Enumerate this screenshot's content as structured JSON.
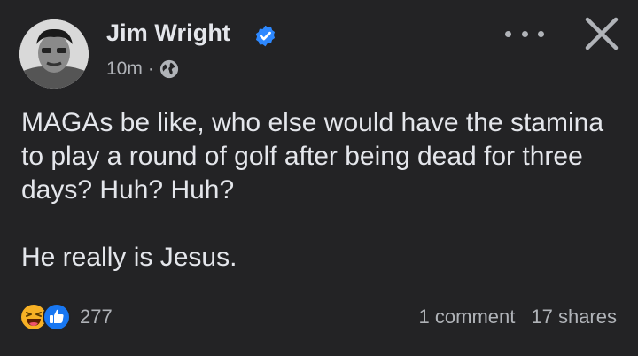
{
  "post": {
    "author": "Jim Wright",
    "time": "10m",
    "separator": "·",
    "verified": true,
    "privacy_icon": "globe-icon",
    "body_lines": [
      "MAGAs be like, who else would have the stamina to play a round of golf after being dead for three days? Huh? Huh?",
      "He really is Jesus."
    ]
  },
  "reactions": {
    "icons": [
      "haha-icon",
      "like-icon"
    ],
    "count": "277"
  },
  "stats": {
    "comments": "1 comment",
    "shares": "17 shares"
  },
  "colors": {
    "background": "#232325",
    "text_primary": "#e4e6eb",
    "text_secondary": "#b0b3b8",
    "verified": "#2d88ff",
    "like": "#1877f2",
    "haha": "#f7b125"
  }
}
